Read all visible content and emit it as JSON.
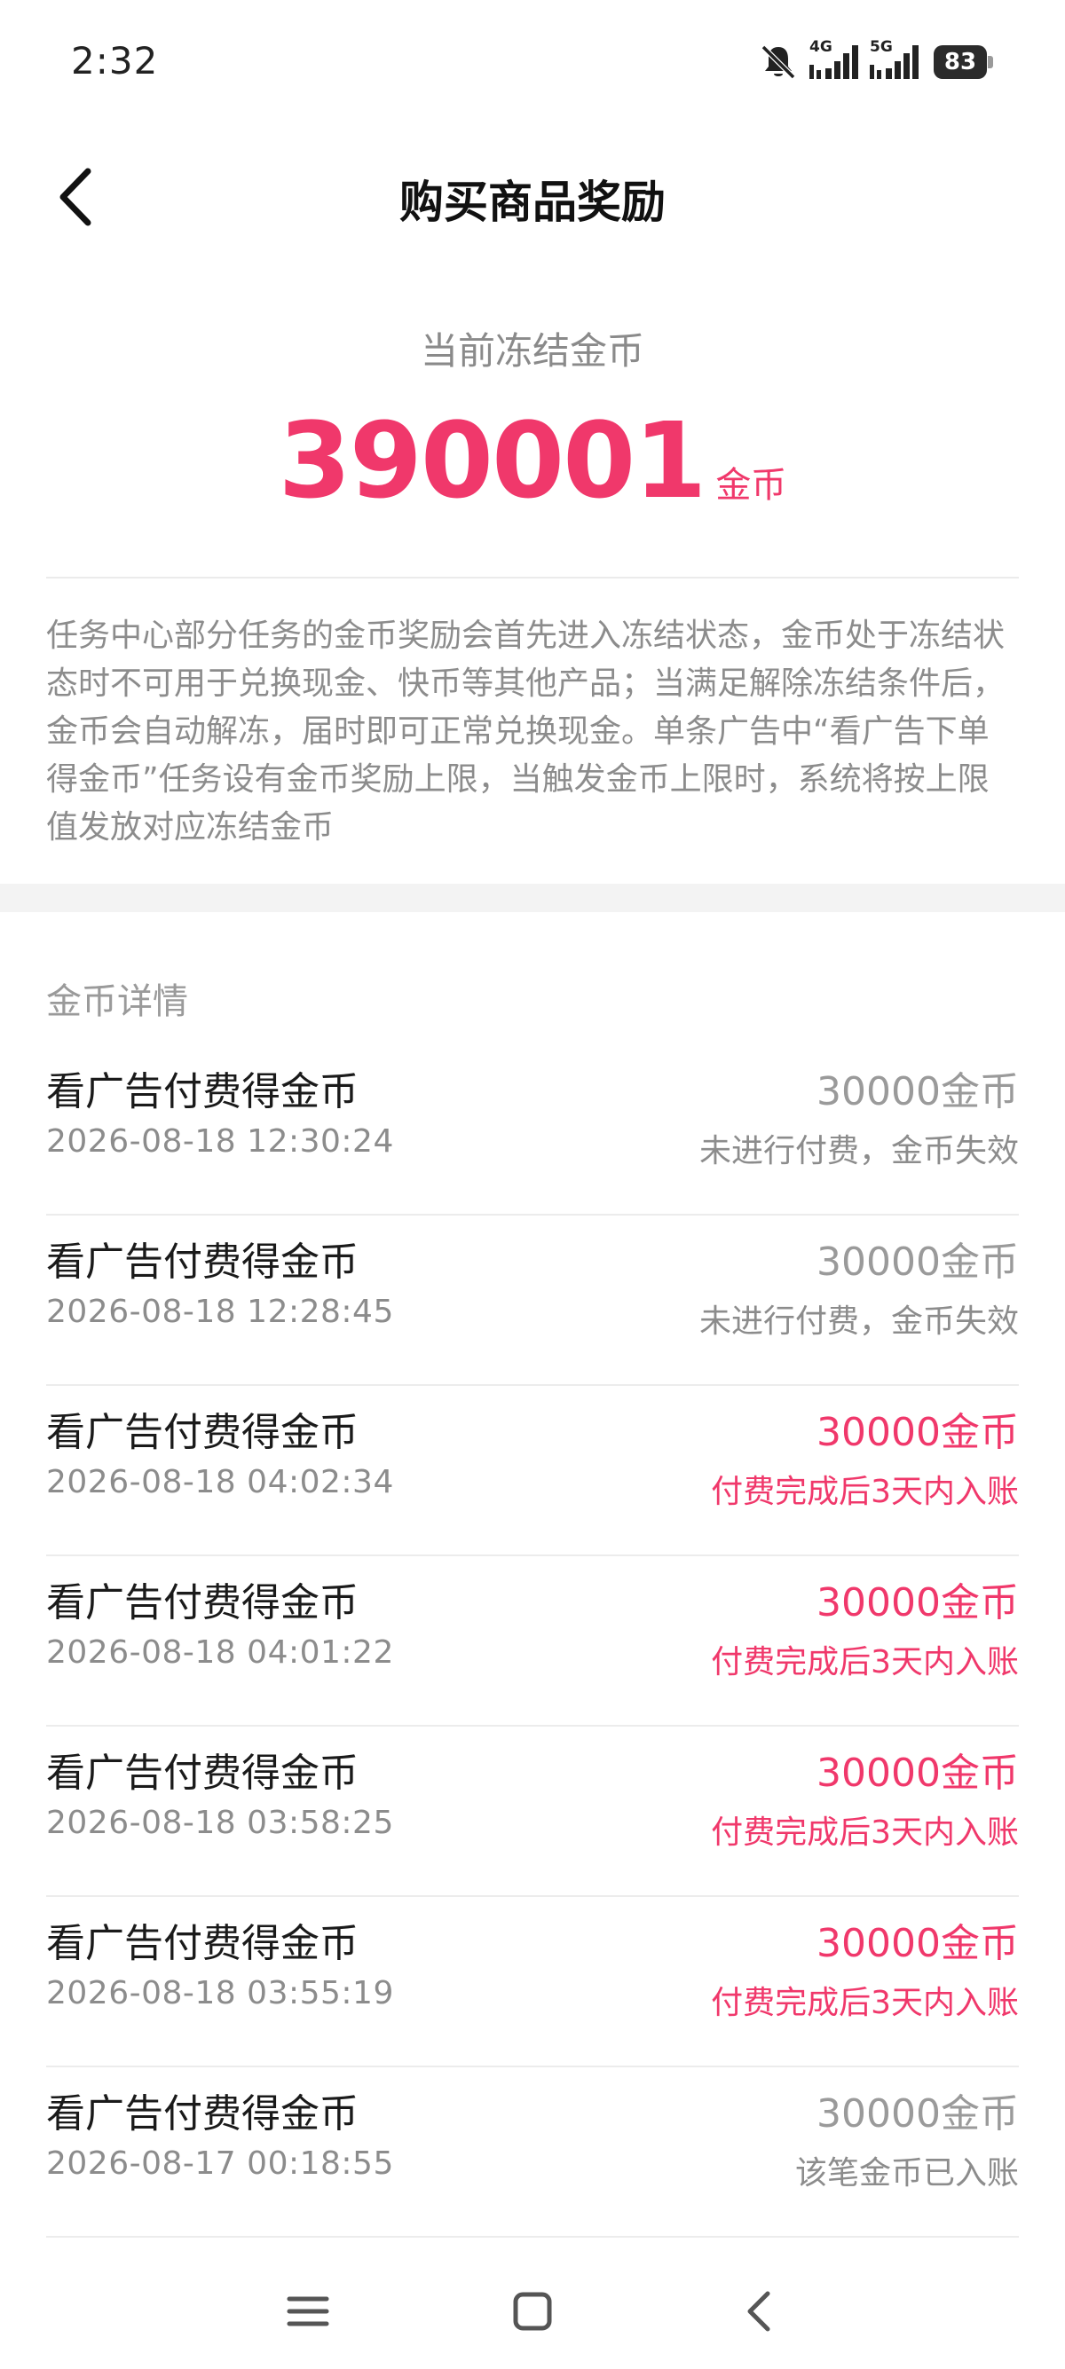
{
  "status_bar": {
    "time": "2:32",
    "network_1": "4G",
    "network_2": "5G",
    "battery": "83"
  },
  "header": {
    "title": "购买商品奖励"
  },
  "summary": {
    "label": "当前冻结金币",
    "amount": "390001",
    "unit": "金币"
  },
  "notice": "任务中心部分任务的金币奖励会首先进入冻结状态，金币处于冻结状态时不可用于兑换现金、快币等其他产品；当满足解除冻结条件后，金币会自动解冻，届时即可正常兑换现金。单条广告中“看广告下单得金币”任务设有金币奖励上限，当触发金币上限时，系统将按上限值发放对应冻结金币",
  "details": {
    "title": "金币详情",
    "records": [
      {
        "title": "看广告付费得金币",
        "time": "2026-08-18 12:30:24",
        "amount": "30000金币",
        "status": "未进行付费，金币失效"
      },
      {
        "title": "看广告付费得金币",
        "time": "2026-08-18 12:28:45",
        "amount": "30000金币",
        "status": "未进行付费，金币失效"
      },
      {
        "title": "看广告付费得金币",
        "time": "2026-08-18 04:02:34",
        "amount": "30000金币",
        "status": "付费完成后3天内入账"
      },
      {
        "title": "看广告付费得金币",
        "time": "2026-08-18 04:01:22",
        "amount": "30000金币",
        "status": "付费完成后3天内入账"
      },
      {
        "title": "看广告付费得金币",
        "time": "2026-08-18 03:58:25",
        "amount": "30000金币",
        "status": "付费完成后3天内入账"
      },
      {
        "title": "看广告付费得金币",
        "time": "2026-08-18 03:55:19",
        "amount": "30000金币",
        "status": "付费完成后3天内入账"
      },
      {
        "title": "看广告付费得金币",
        "time": "2026-08-17 00:18:55",
        "amount": "30000金币",
        "status": "该笔金币已入账"
      }
    ]
  },
  "colors": {
    "accent": "#f0386b",
    "muted": "#8c8c8c"
  },
  "icons": {
    "back": "chevron-left-icon",
    "nav_menu": "menu-icon",
    "nav_home": "square-home-icon",
    "nav_back": "back-triangle-icon"
  }
}
